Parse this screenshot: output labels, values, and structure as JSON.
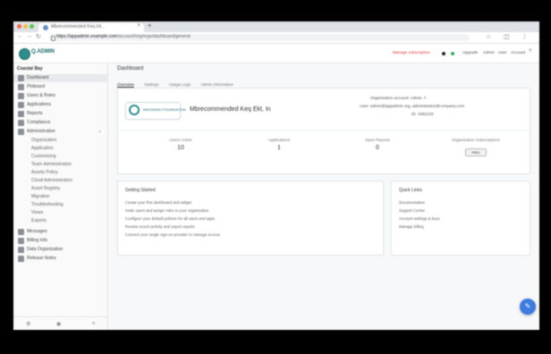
{
  "browser": {
    "tab_title": "Mbrecommended Keq Int...",
    "tab_close": "×",
    "new_tab": "+",
    "url_domain": "https://appadmin.example.com",
    "url_path": "/account/org/orgs/dashboard/general",
    "back_icon": "arrow-left-icon",
    "forward_icon": "arrow-right-icon",
    "reload_icon": "reload-icon",
    "menu_icon": "more-vertical-icon"
  },
  "header": {
    "logo_text": "Q.ADMIN",
    "subscription_link": "Manage subscription",
    "links": [
      "Upgrade",
      "Admin",
      "User",
      "Account"
    ],
    "help_icon": "help-icon"
  },
  "sidebar": {
    "header": "Coastal Bay",
    "items": [
      {
        "label": "Dashboard",
        "active": true
      },
      {
        "label": "Pinboard"
      },
      {
        "label": "Users & Roles"
      },
      {
        "label": "Applications"
      },
      {
        "label": "Reports"
      },
      {
        "label": "Compliance"
      },
      {
        "label": "Administration",
        "expanded": true
      }
    ],
    "sub_items": [
      "Organization",
      "Application",
      "Customizing",
      "Team Administration",
      "Assets Policy",
      "Cloud Administration",
      "Asset Registry",
      "Migration",
      "Troubleshooting",
      "Views",
      "Exports"
    ],
    "bottom_items": [
      "Messages",
      "Billing Info",
      "Data Organization",
      "Release Notes"
    ],
    "footer_icons": [
      "settings-icon",
      "user-icon",
      "collapse-icon"
    ]
  },
  "main": {
    "page_title": "Dashboard",
    "tabs": [
      "Overview",
      "Settings",
      "Usage Logs",
      "Admin Information"
    ],
    "org": {
      "logo_text": "MIKOWSKI FOUNDATION",
      "name": "Mbrecommended Keq Ekt, In",
      "meta_1": "Organization account: Admin ↗",
      "meta_2": "User: admin@appadmin.org, administrator@company.com",
      "meta_3": "ID: 4392103"
    },
    "stats": [
      {
        "label": "Users Active",
        "value": "10"
      },
      {
        "label": "Applications",
        "value": "1"
      },
      {
        "label": "Open Reports",
        "value": "0"
      },
      {
        "label": "Organization Subscriptions",
        "value": "PRO"
      }
    ],
    "tips": {
      "title": "Getting Started",
      "lines": [
        "Create your first dashboard and widget",
        "Invite users and assign roles to your organization",
        "Configure your default policies for all users and apps",
        "Review recent activity and export reports",
        "Connect your single sign-on provider to manage access"
      ]
    },
    "links": {
      "title": "Quick Links",
      "lines": [
        "Documentation",
        "Support Center",
        "Account settings & keys",
        "Manage billing"
      ]
    }
  },
  "fab": {
    "icon": "chat-icon",
    "glyph": "✎"
  }
}
